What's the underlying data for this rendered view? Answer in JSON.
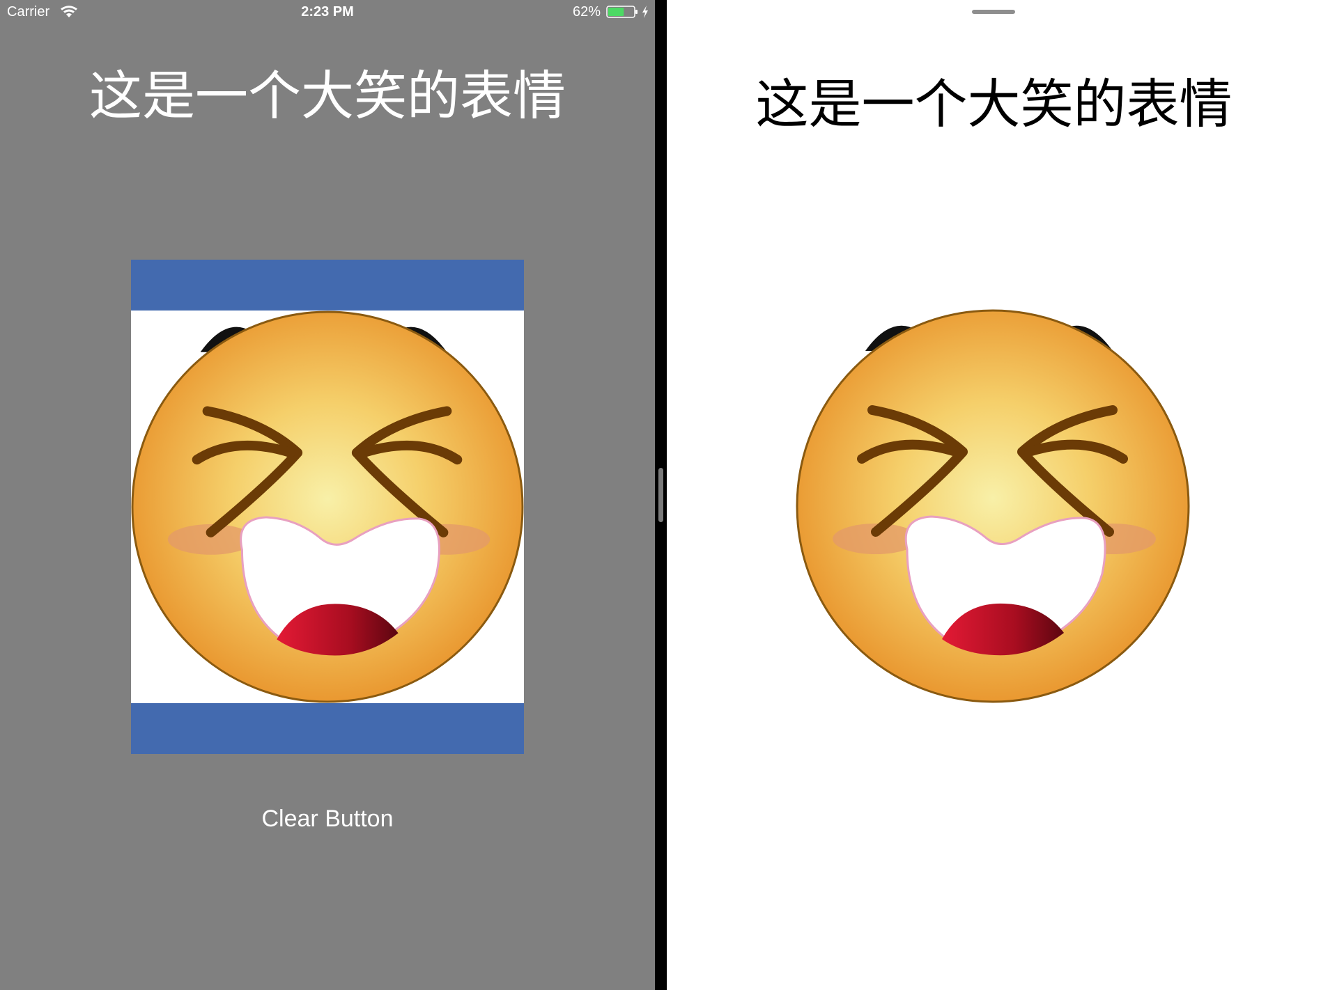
{
  "status_bar": {
    "carrier": "Carrier",
    "time": "2:23 PM",
    "battery_percent": "62%",
    "battery_level": 0.62
  },
  "left_pane": {
    "title": "这是一个大笑的表情",
    "image_frame_color": "#436aaf",
    "clear_button_label": "Clear Button"
  },
  "right_pane": {
    "title": "这是一个大笑的表情"
  },
  "colors": {
    "left_background": "#808080",
    "right_background": "#ffffff",
    "divider": "#000000",
    "battery_fill": "#4cd964"
  },
  "icons": [
    "wifi-icon",
    "battery-icon",
    "charging-bolt-icon",
    "laughing-face-image"
  ]
}
